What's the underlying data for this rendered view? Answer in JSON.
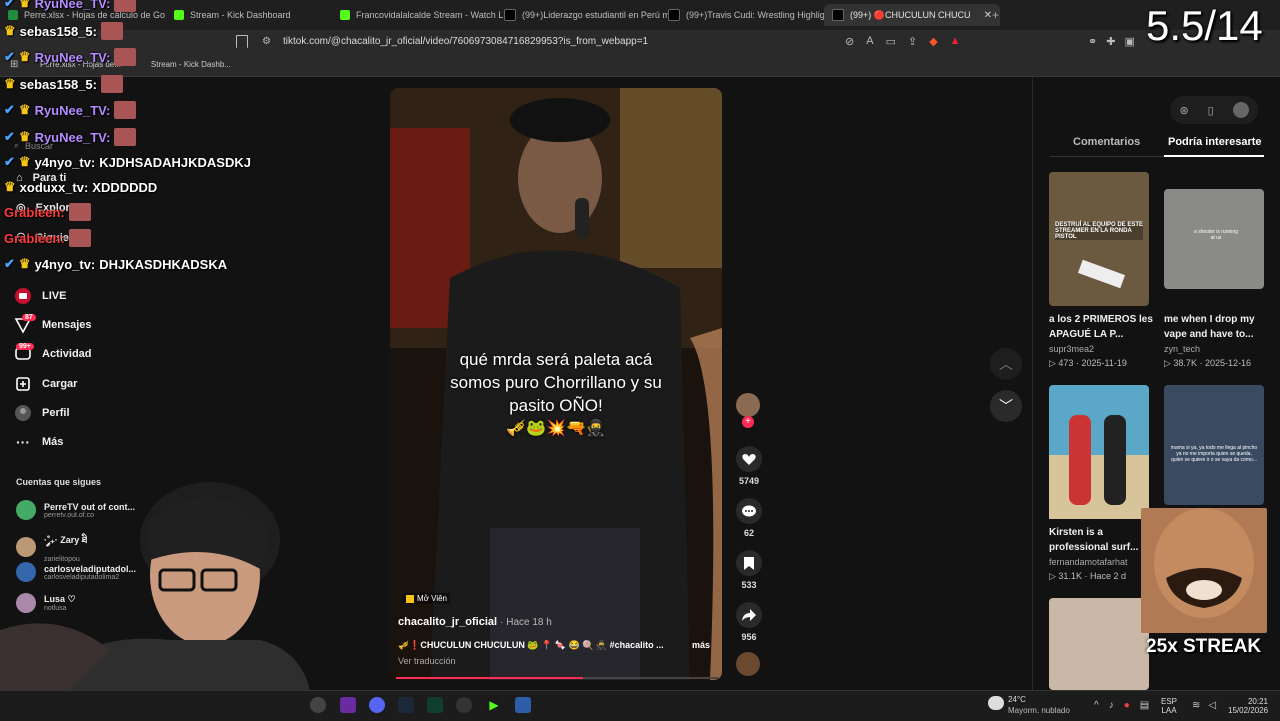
{
  "browser": {
    "tabs": [
      {
        "label": "Perre.xlsx - Hojas de cálculo de Go",
        "color": "#1e8e3e"
      },
      {
        "label": "Stream - Kick Dashboard",
        "color": "#53fc18"
      },
      {
        "label": "Francovidalalcalde Stream - Watch L",
        "color": "#53fc18"
      },
      {
        "label": "(99+)Liderazgo estudiantil en Perú m",
        "color": "#111"
      },
      {
        "label": "(99+)Travis Cudi: Wrestling Highlight",
        "color": "#111"
      },
      {
        "label": "(99+) 🔴CHUCULUN CHUCU",
        "color": "#111"
      }
    ],
    "url": "tiktok.com/@chacalito_jr_oficial/video/7606973084716829953?is_from_webapp=1",
    "bookmarks": [
      "Perre.xlsx - Hojas de...",
      "Stream - Kick Dashb..."
    ]
  },
  "overlay_counter": "5.5/14",
  "chat": [
    {
      "user": "RyuNee_TV:",
      "msg": "",
      "color": "#b48cff"
    },
    {
      "user": "sebas158_5:",
      "msg": "",
      "color": "#ffffff"
    },
    {
      "user": "RyuNee_TV:",
      "msg": "",
      "color": "#b48cff"
    },
    {
      "user": "sebas158_5:",
      "msg": "",
      "color": "#ffffff"
    },
    {
      "user": "RyuNee_TV:",
      "msg": "",
      "color": "#b48cff"
    },
    {
      "user": "RyuNee_TV:",
      "msg": "",
      "color": "#b48cff"
    },
    {
      "user": "y4nyo_tv:",
      "msg": "KJDHSADAHJKDASDKJ",
      "color": "#ffffff"
    },
    {
      "user": "xoduxx_tv:",
      "msg": "XDDDDDD",
      "color": "#ffffff"
    },
    {
      "user": "Grableen:",
      "msg": "",
      "color": "#ff3b3b"
    },
    {
      "user": "Grableen:",
      "msg": "",
      "color": "#ff3b3b"
    },
    {
      "user": "y4nyo_tv:",
      "msg": "DHJKASDHKADSKA",
      "color": "#ffffff"
    }
  ],
  "sidebar": {
    "partial_items": [
      "Buscar",
      "Para ti",
      "Explorar",
      "Siguiendo"
    ],
    "items": [
      {
        "label": "LIVE",
        "icon": "live-icon"
      },
      {
        "label": "Mensajes",
        "icon": "messages-icon",
        "badge": "87"
      },
      {
        "label": "Actividad",
        "icon": "activity-icon",
        "badge": "99+"
      },
      {
        "label": "Cargar",
        "icon": "upload-icon"
      },
      {
        "label": "Perfil",
        "icon": "profile-icon"
      },
      {
        "label": "Más",
        "icon": "more-icon"
      }
    ],
    "following_title": "Cuentas que sigues",
    "following": [
      {
        "name": "PerreTV out of cont...",
        "handle": "perretv.out.of.co"
      },
      {
        "name": "·˚༘₊· Zary ཐི",
        "handle": "zarielitopou"
      },
      {
        "name": "carlosveladiputadol...",
        "handle": "carlosveladiputadolima2"
      },
      {
        "name": "Lusa ♡",
        "handle": "notlusa"
      }
    ]
  },
  "video": {
    "caption_lines": [
      "qué mrda será paleta acá",
      "somos puro Chorrillano y su",
      "pasito OÑO!"
    ],
    "caption_emojis": "🎺🐸💥🔫🥷",
    "tag": "Mở Viên",
    "author": "chacalito_jr_oficial",
    "time": "· Hace 18 h",
    "description": "🎺❗CHUCULUN CHUCULUN 🐸 📍 🍬 😂 🍭 🥷 #chacalito ...",
    "more": "más",
    "translate": "Ver traducción",
    "likes": "5749",
    "comments": "62",
    "saves": "533",
    "shares": "956"
  },
  "right_panel": {
    "tabs": [
      "Comentarios",
      "Podría interesarte"
    ],
    "cards": [
      {
        "title": "a los 2 PRIMEROS les APAGUÉ LA P...",
        "user": "supr3mea2",
        "views": "473",
        "date": "2025-11-19",
        "thumb_text": "DESTRUÍ AL EQUIPO DE ESTE STREAMER EN LA RONDA PISTOL"
      },
      {
        "title": "me when I drop my vape and have to...",
        "user": "zyn_tech",
        "views": "38.7K",
        "date": "2025-12-16",
        "thumb_text": "a shooter is running at us"
      },
      {
        "title": "Kirsten is a professional surf...",
        "user": "fernandamotafarhat",
        "views": "31.1K",
        "date": "Hace 2 d",
        "thumb_text": ""
      },
      {
        "title": "",
        "user": "",
        "views": "",
        "date": "",
        "thumb_text": "mama si ya, ya todo me llega al pincho ya no me importa quien se queda, quien se quiere ir o se vaya da como..."
      }
    ]
  },
  "streak_label": "25x STREAK",
  "taskbar": {
    "weather_temp": "24°C",
    "weather_desc": "Mayorm. nublado",
    "lang": "ESP",
    "lang2": "LAA",
    "time": "20:21",
    "date": "15/02/2026"
  }
}
